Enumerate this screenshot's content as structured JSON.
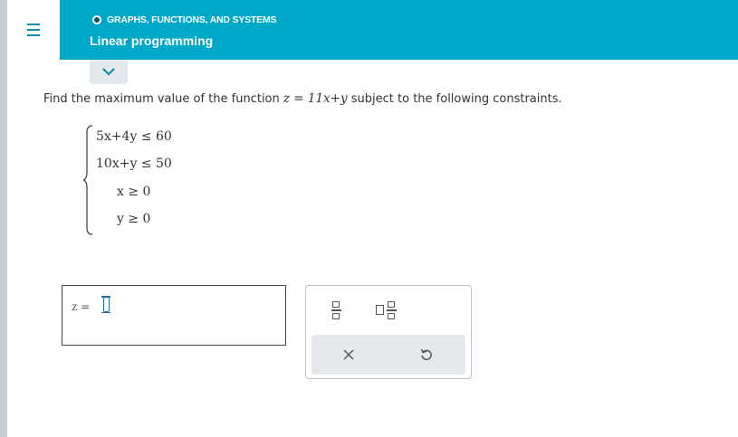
{
  "header": {
    "topic": "GRAPHS, FUNCTIONS, AND SYSTEMS",
    "title": "Linear programming",
    "menu_icon": "hamburger-menu-icon",
    "collapse_icon": "chevron-down-icon"
  },
  "colors": {
    "header_bg": "#00a8c8",
    "rail": "#c9ced3",
    "keypad_bar": "#e4e8ec"
  },
  "question": {
    "prefix": "Find the maximum value of the function ",
    "function": "z = 11x+y",
    "suffix": " subject to the following constraints."
  },
  "constraints": [
    "5x+4y ≤ 60",
    "10x+y ≤ 50",
    "x ≥ 0",
    "y ≥ 0"
  ],
  "answer": {
    "label": "z =",
    "value": ""
  },
  "keypad": {
    "keys": [
      "fraction-icon",
      "mixed-number-icon"
    ],
    "actions": [
      "clear-x-icon",
      "undo-icon"
    ]
  }
}
